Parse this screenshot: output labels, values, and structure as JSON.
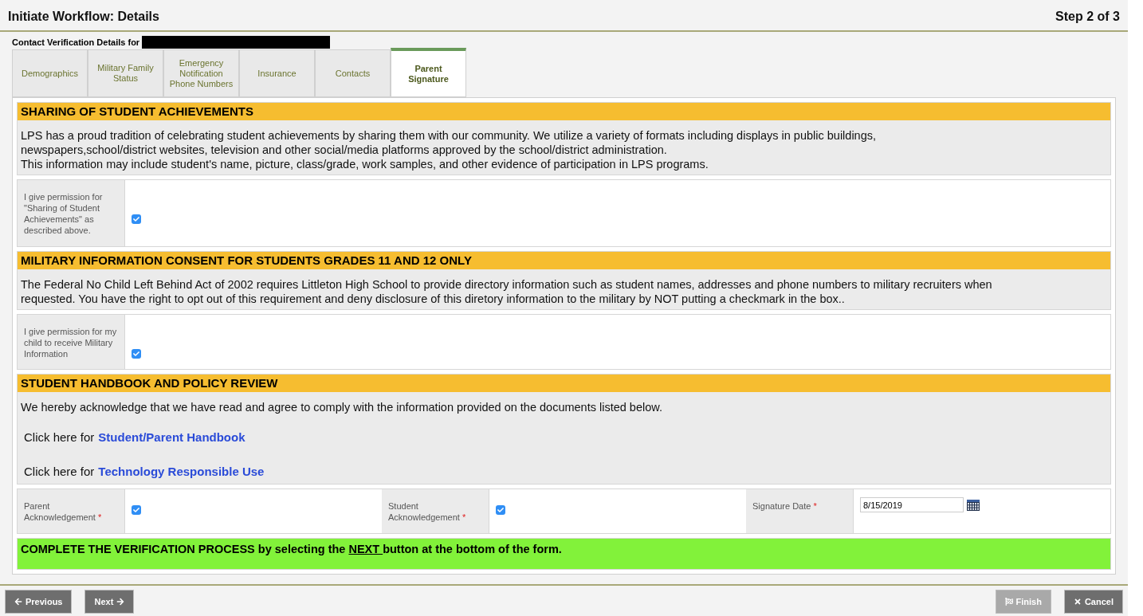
{
  "header": {
    "title": "Initiate Workflow: Details",
    "step": "Step 2 of 3"
  },
  "subtitle": "Contact Verification Details for",
  "tabs": [
    {
      "label": "Demographics",
      "selected": false
    },
    {
      "label": "Military Family Status",
      "selected": false
    },
    {
      "label": "Emergency Notification Phone Numbers",
      "selected": false
    },
    {
      "label": "Insurance",
      "selected": false
    },
    {
      "label": "Contacts",
      "selected": false
    },
    {
      "label": "Parent Signature",
      "selected": true
    }
  ],
  "sections": [
    {
      "heading": "SHARING OF STUDENT ACHIEVEMENTS",
      "paragraphs": [
        "LPS has a proud tradition of celebrating student achievements by sharing them with our community. We utilize a variety of formats including displays in public buildings, newspapers,school/district websites, television and other social/media platforms approved by the school/district administration.",
        "This information may include student's name, picture, class/grade, work samples, and other evidence of participation in LPS programs."
      ],
      "fields": [
        {
          "kind": "checkbox",
          "label": "I give permission for \"Sharing of Student Achievements\" as described above.",
          "checked": true
        }
      ]
    },
    {
      "heading": "MILITARY INFORMATION CONSENT FOR STUDENTS GRADES 11 AND 12 ONLY",
      "paragraphs": [
        "The Federal No Child Left Behind Act of 2002 requires Littleton High School to provide directory information such as student names, addresses and phone numbers to military recruiters when requested. You have the right to opt out of this requirement and deny disclosure of this diretory information to the military by NOT putting a checkmark in the box.."
      ],
      "fields": [
        {
          "kind": "checkbox",
          "label": "I give permission for my child to receive Military Information",
          "checked": true
        }
      ]
    },
    {
      "heading": "STUDENT HANDBOOK AND POLICY REVIEW",
      "paragraphs": [
        "We hereby acknowledge that we have read and agree to comply with the information provided on the documents listed below."
      ],
      "links": [
        {
          "prefix": "Click here for",
          "text": "Student/Parent Handbook"
        },
        {
          "prefix": "Click here for",
          "text": "Technology Responsible Use"
        }
      ],
      "fields": [
        {
          "kind": "checkbox",
          "label": "Parent Acknowledgement",
          "required_mark": "*",
          "checked": true
        },
        {
          "kind": "checkbox",
          "label": "Student Acknowledgement",
          "required_mark": "*",
          "checked": true
        },
        {
          "kind": "date",
          "label": "Signature Date",
          "required_mark": "*",
          "value": "8/15/2019"
        }
      ]
    }
  ],
  "notice": {
    "before": "COMPLETE THE VERIFICATION PROCESS by selecting the",
    "emphasis": "NEXT ",
    "after": "button at the bottom of the form."
  },
  "buttons": [
    {
      "kind": "previous",
      "label": "Previous",
      "disabled": false
    },
    {
      "kind": "next",
      "label": "Next",
      "disabled": false
    },
    {
      "kind": "finish",
      "label": "Finish",
      "disabled": true
    },
    {
      "kind": "cancel",
      "label": "Cancel",
      "disabled": false
    }
  ]
}
